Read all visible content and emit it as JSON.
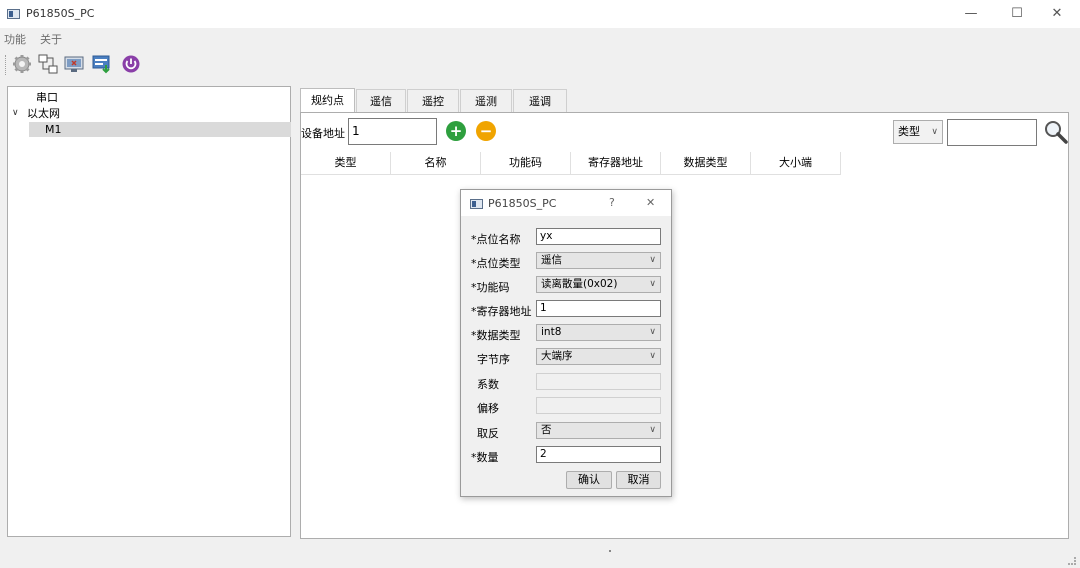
{
  "window": {
    "title": "P61850S_PC",
    "min": "—",
    "max": "☐",
    "close": "✕"
  },
  "menu": [
    "功能",
    "关于"
  ],
  "toolbar": {
    "icons": [
      "gear-icon",
      "network-icon",
      "monitor-icon",
      "download-icon",
      "power-icon"
    ]
  },
  "tree": {
    "items": [
      {
        "label": "串口",
        "expanded": false
      },
      {
        "label": "以太网",
        "expanded": true,
        "arrow": "∨"
      },
      {
        "label": "M1",
        "selected": true
      }
    ]
  },
  "tabs": [
    "规约点",
    "遥信",
    "遥控",
    "遥测",
    "遥调"
  ],
  "device": {
    "label": "设备地址",
    "value": "1",
    "add": "+",
    "remove": "−"
  },
  "filter": {
    "type_label": "类型",
    "search_value": ""
  },
  "grid": {
    "columns": [
      "类型",
      "名称",
      "功能码",
      "寄存器地址",
      "数据类型",
      "大小端"
    ]
  },
  "dialog": {
    "title": "P61850S_PC",
    "help": "?",
    "close": "✕",
    "fields": [
      {
        "label": "*点位名称",
        "value": "yx",
        "kind": "input"
      },
      {
        "label": "*点位类型",
        "value": "遥信",
        "kind": "combo"
      },
      {
        "label": "*功能码",
        "value": "读离散量(0x02)",
        "kind": "combo"
      },
      {
        "label": "*寄存器地址",
        "value": "1",
        "kind": "input"
      },
      {
        "label": "*数据类型",
        "value": "int8",
        "kind": "combo"
      },
      {
        "label": "字节序",
        "value": "大端序",
        "kind": "combo"
      },
      {
        "label": "系数",
        "value": "",
        "kind": "disabled"
      },
      {
        "label": "偏移",
        "value": "",
        "kind": "disabled"
      },
      {
        "label": "取反",
        "value": "否",
        "kind": "combo"
      },
      {
        "label": "*数量",
        "value": "2",
        "kind": "input"
      }
    ],
    "ok": "确认",
    "cancel": "取消"
  },
  "colors": {
    "add": "#2e9f3e",
    "remove": "#f0a400",
    "selection": "#dadada"
  }
}
